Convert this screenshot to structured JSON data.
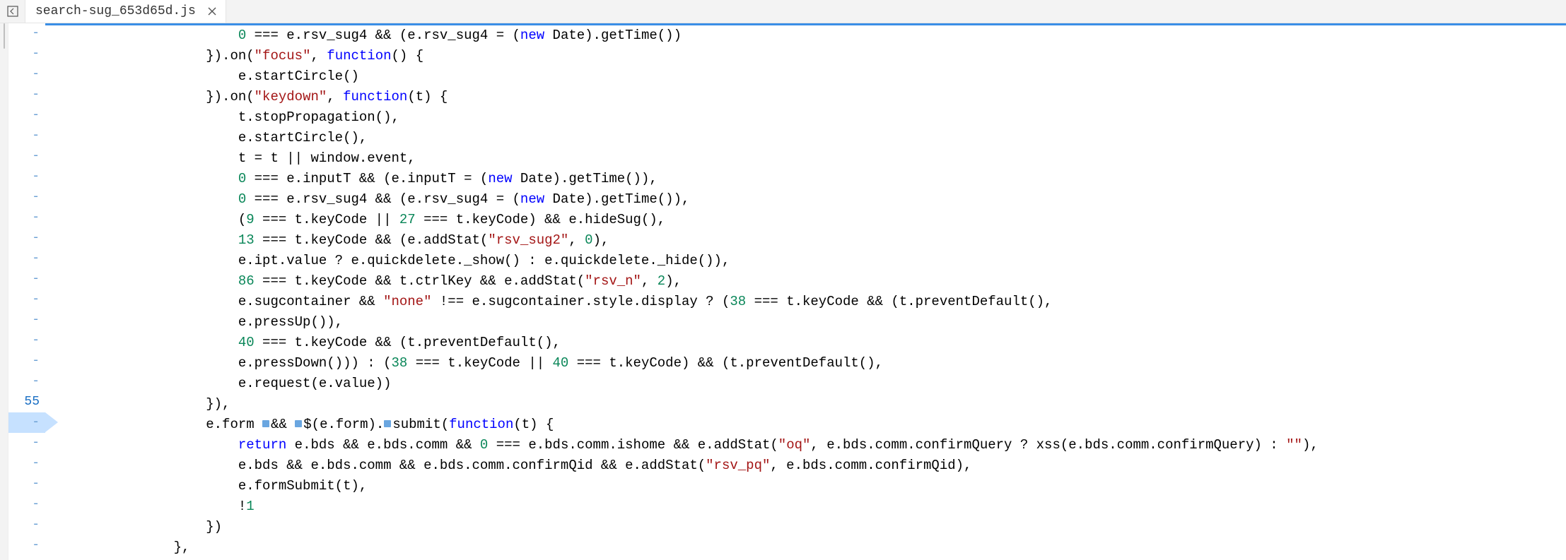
{
  "tab": {
    "filename": "search-sug_653d65d.js",
    "close_tooltip": "Close"
  },
  "gutter": {
    "dash": "-",
    "active_line_number": "55",
    "rows": [
      "-",
      "-",
      "-",
      "-",
      "-",
      "-",
      "-",
      "-",
      "-",
      "-",
      "-",
      "-",
      "-",
      "-",
      "-",
      "-",
      "-",
      "-",
      "55",
      "-",
      "-",
      "-",
      "-",
      "-",
      "-",
      "-"
    ]
  },
  "code": {
    "lines": [
      [
        {
          "indent": 22,
          "cls": "tok-num",
          "text": "0"
        },
        {
          "cls": "tok-punc",
          "text": " === e.rsv_sug4 && (e.rsv_sug4 = ("
        },
        {
          "cls": "tok-kw",
          "text": "new"
        },
        {
          "cls": "tok-punc",
          "text": " Date).getTime())"
        }
      ],
      [
        {
          "indent": 18,
          "cls": "tok-punc",
          "text": "}).on("
        },
        {
          "cls": "tok-str",
          "text": "\"focus\""
        },
        {
          "cls": "tok-punc",
          "text": ", "
        },
        {
          "cls": "tok-kw",
          "text": "function"
        },
        {
          "cls": "tok-punc",
          "text": "() {"
        }
      ],
      [
        {
          "indent": 22,
          "cls": "tok-punc",
          "text": "e.startCircle()"
        }
      ],
      [
        {
          "indent": 18,
          "cls": "tok-punc",
          "text": "}).on("
        },
        {
          "cls": "tok-str",
          "text": "\"keydown\""
        },
        {
          "cls": "tok-punc",
          "text": ", "
        },
        {
          "cls": "tok-kw",
          "text": "function"
        },
        {
          "cls": "tok-punc",
          "text": "(t) {"
        }
      ],
      [
        {
          "indent": 22,
          "cls": "tok-punc",
          "text": "t.stopPropagation(),"
        }
      ],
      [
        {
          "indent": 22,
          "cls": "tok-punc",
          "text": "e.startCircle(),"
        }
      ],
      [
        {
          "indent": 22,
          "cls": "tok-punc",
          "text": "t = t || window.event,"
        }
      ],
      [
        {
          "indent": 22,
          "cls": "tok-num",
          "text": "0"
        },
        {
          "cls": "tok-punc",
          "text": " === e.inputT && (e.inputT = ("
        },
        {
          "cls": "tok-kw",
          "text": "new"
        },
        {
          "cls": "tok-punc",
          "text": " Date).getTime()),"
        }
      ],
      [
        {
          "indent": 22,
          "cls": "tok-num",
          "text": "0"
        },
        {
          "cls": "tok-punc",
          "text": " === e.rsv_sug4 && (e.rsv_sug4 = ("
        },
        {
          "cls": "tok-kw",
          "text": "new"
        },
        {
          "cls": "tok-punc",
          "text": " Date).getTime()),"
        }
      ],
      [
        {
          "indent": 22,
          "cls": "tok-punc",
          "text": "("
        },
        {
          "cls": "tok-num",
          "text": "9"
        },
        {
          "cls": "tok-punc",
          "text": " === t.keyCode || "
        },
        {
          "cls": "tok-num",
          "text": "27"
        },
        {
          "cls": "tok-punc",
          "text": " === t.keyCode) && e.hideSug(),"
        }
      ],
      [
        {
          "indent": 22,
          "cls": "tok-num",
          "text": "13"
        },
        {
          "cls": "tok-punc",
          "text": " === t.keyCode && (e.addStat("
        },
        {
          "cls": "tok-str",
          "text": "\"rsv_sug2\""
        },
        {
          "cls": "tok-punc",
          "text": ", "
        },
        {
          "cls": "tok-num",
          "text": "0"
        },
        {
          "cls": "tok-punc",
          "text": "),"
        }
      ],
      [
        {
          "indent": 22,
          "cls": "tok-punc",
          "text": "e.ipt.value ? e.quickdelete._show() : e.quickdelete._hide()),"
        }
      ],
      [
        {
          "indent": 22,
          "cls": "tok-num",
          "text": "86"
        },
        {
          "cls": "tok-punc",
          "text": " === t.keyCode && t.ctrlKey && e.addStat("
        },
        {
          "cls": "tok-str",
          "text": "\"rsv_n\""
        },
        {
          "cls": "tok-punc",
          "text": ", "
        },
        {
          "cls": "tok-num",
          "text": "2"
        },
        {
          "cls": "tok-punc",
          "text": "),"
        }
      ],
      [
        {
          "indent": 22,
          "cls": "tok-punc",
          "text": "e.sugcontainer && "
        },
        {
          "cls": "tok-str",
          "text": "\"none\""
        },
        {
          "cls": "tok-punc",
          "text": " !== e.sugcontainer.style.display ? ("
        },
        {
          "cls": "tok-num",
          "text": "38"
        },
        {
          "cls": "tok-punc",
          "text": " === t.keyCode && (t.preventDefault(),"
        }
      ],
      [
        {
          "indent": 22,
          "cls": "tok-punc",
          "text": "e.pressUp()),"
        }
      ],
      [
        {
          "indent": 22,
          "cls": "tok-num",
          "text": "40"
        },
        {
          "cls": "tok-punc",
          "text": " === t.keyCode && (t.preventDefault(),"
        }
      ],
      [
        {
          "indent": 22,
          "cls": "tok-punc",
          "text": "e.pressDown())) : ("
        },
        {
          "cls": "tok-num",
          "text": "38"
        },
        {
          "cls": "tok-punc",
          "text": " === t.keyCode || "
        },
        {
          "cls": "tok-num",
          "text": "40"
        },
        {
          "cls": "tok-punc",
          "text": " === t.keyCode) && (t.preventDefault(),"
        }
      ],
      [
        {
          "indent": 22,
          "cls": "tok-punc",
          "text": "e.request(e.value))"
        }
      ],
      [
        {
          "indent": 18,
          "cls": "tok-punc",
          "text": "}),"
        }
      ],
      [
        {
          "indent": 18,
          "cls": "tok-punc",
          "text": "e.form "
        },
        {
          "cls": "marker",
          "text": ""
        },
        {
          "cls": "tok-punc",
          "text": "&& "
        },
        {
          "cls": "marker",
          "text": ""
        },
        {
          "cls": "tok-punc",
          "text": "$(e.form)."
        },
        {
          "cls": "marker",
          "text": ""
        },
        {
          "cls": "tok-punc",
          "text": "submit("
        },
        {
          "cls": "tok-kw",
          "text": "function"
        },
        {
          "cls": "tok-punc",
          "text": "(t) {"
        }
      ],
      [
        {
          "indent": 22,
          "cls": "tok-kw",
          "text": "return"
        },
        {
          "cls": "tok-punc",
          "text": " e.bds && e.bds.comm && "
        },
        {
          "cls": "tok-num",
          "text": "0"
        },
        {
          "cls": "tok-punc",
          "text": " === e.bds.comm.ishome && e.addStat("
        },
        {
          "cls": "tok-str",
          "text": "\"oq\""
        },
        {
          "cls": "tok-punc",
          "text": ", e.bds.comm.confirmQuery ? xss(e.bds.comm.confirmQuery) : "
        },
        {
          "cls": "tok-str",
          "text": "\"\""
        },
        {
          "cls": "tok-punc",
          "text": "),"
        }
      ],
      [
        {
          "indent": 22,
          "cls": "tok-punc",
          "text": "e.bds && e.bds.comm && e.bds.comm.confirmQid && e.addStat("
        },
        {
          "cls": "tok-str",
          "text": "\"rsv_pq\""
        },
        {
          "cls": "tok-punc",
          "text": ", e.bds.comm.confirmQid),"
        }
      ],
      [
        {
          "indent": 22,
          "cls": "tok-punc",
          "text": "e.formSubmit(t),"
        }
      ],
      [
        {
          "indent": 22,
          "cls": "tok-punc",
          "text": "!"
        },
        {
          "cls": "tok-num",
          "text": "1"
        }
      ],
      [
        {
          "indent": 18,
          "cls": "tok-punc",
          "text": "})"
        }
      ],
      [
        {
          "indent": 14,
          "cls": "tok-punc",
          "text": "},"
        }
      ]
    ]
  }
}
